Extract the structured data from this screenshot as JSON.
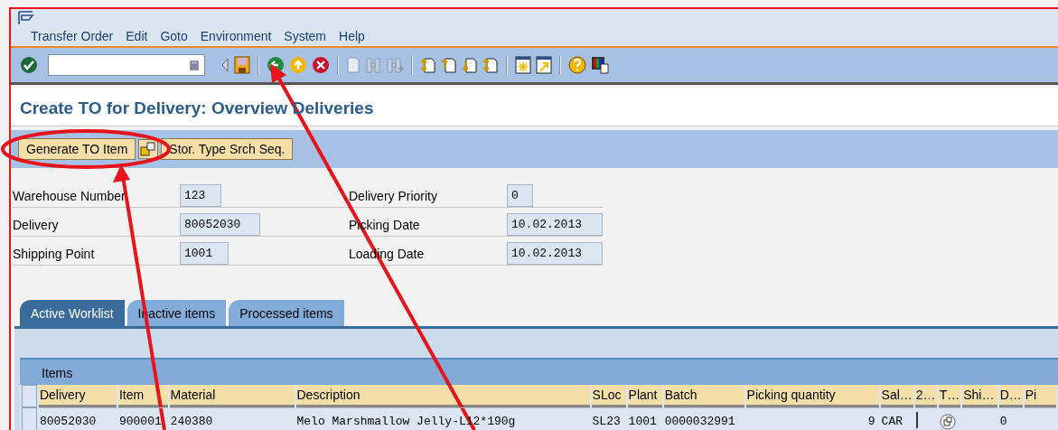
{
  "menu": [
    "Transfer Order",
    "Edit",
    "Goto",
    "Environment",
    "System",
    "Help"
  ],
  "title": "Create TO for Delivery: Overview Deliveries",
  "app_buttons": [
    {
      "kind": "text",
      "label": "Generate TO Item"
    },
    {
      "kind": "icon"
    },
    {
      "kind": "text",
      "label": "Stor. Type Srch Seq."
    }
  ],
  "fields_left": [
    {
      "label": "Warehouse Number",
      "value": "123"
    },
    {
      "label": "Delivery",
      "value": "80052030"
    },
    {
      "label": "Shipping Point",
      "value": "1001"
    }
  ],
  "fields_right": [
    {
      "label": "Delivery Priority",
      "value": "0"
    },
    {
      "label": "Picking Date",
      "value": "10.02.2013"
    },
    {
      "label": "Loading Date",
      "value": "10.02.2013"
    }
  ],
  "tabs": [
    {
      "label": "Active Worklist",
      "selected": true
    },
    {
      "label": "Inactive items",
      "selected": false
    },
    {
      "label": "Processed items",
      "selected": false
    }
  ],
  "table": {
    "title": "Items",
    "columns": [
      "Delivery",
      "Item",
      "Material",
      "Description",
      "SLoc",
      "Plant",
      "Batch",
      "Picking quantity",
      "Sal…",
      "2…",
      "T…",
      "Shi…",
      "D…",
      "Pi"
    ],
    "rows": [
      {
        "cells": [
          {
            "kind": "text",
            "text": "80052030"
          },
          {
            "kind": "text",
            "text": "900001"
          },
          {
            "kind": "text",
            "text": "240380"
          },
          {
            "kind": "text",
            "text": "Melo Marshmallow Jelly-L12*190g"
          },
          {
            "kind": "text",
            "text": "SL23"
          },
          {
            "kind": "text",
            "text": "1001"
          },
          {
            "kind": "text",
            "text": "0000032991"
          },
          {
            "kind": "number",
            "text": "9"
          },
          {
            "kind": "text",
            "text": "CAR"
          },
          {
            "kind": "field"
          },
          {
            "kind": "icon"
          },
          {
            "kind": "blank"
          },
          {
            "kind": "text",
            "text": "0"
          },
          {
            "kind": "blank"
          }
        ]
      }
    ]
  }
}
